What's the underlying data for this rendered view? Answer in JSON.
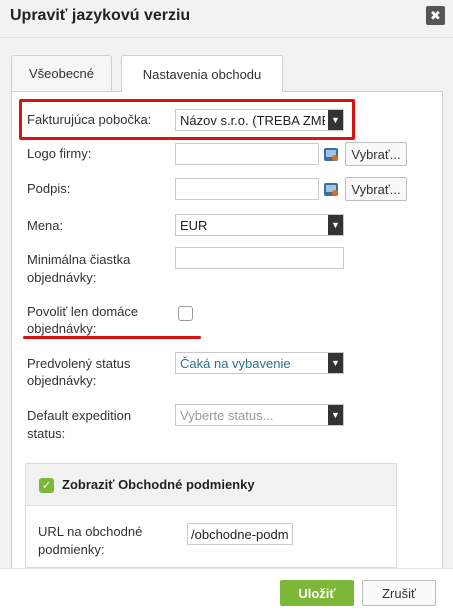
{
  "dialog": {
    "title": "Upraviť jazykovú verziu",
    "close_glyph": "✖"
  },
  "tabs": [
    {
      "label": "Všeobecné",
      "active": false
    },
    {
      "label": "Nastavenia obchodu",
      "active": true
    }
  ],
  "form": {
    "branch": {
      "label": "Fakturujúca pobočka:",
      "value": "Názov s.r.o. (TREBA ZME"
    },
    "logo": {
      "label": "Logo firmy:",
      "value": "",
      "button": "Vybrať..."
    },
    "signature": {
      "label": "Podpis:",
      "value": "",
      "button": "Vybrať..."
    },
    "currency": {
      "label": "Mena:",
      "value": "EUR"
    },
    "min_order": {
      "label_line1": "Minimálna čiastka",
      "label_line2": "objednávky:",
      "value": ""
    },
    "domestic_only": {
      "label_line1": "Povoliť len domáce",
      "label_line2": "objednávky:",
      "checked": false
    },
    "default_status": {
      "label_line1": "Predvolený status",
      "label_line2": "objednávky:",
      "value": "Čaká na vybavenie"
    },
    "default_expedition": {
      "label_line1": "Default expedition",
      "label_line2": "status:",
      "placeholder": "Vyberte status..."
    }
  },
  "terms_section": {
    "title": "Zobraziť Obchodné podmienky",
    "checked": true,
    "url_label_line1": "URL na obchodné",
    "url_label_line2": "podmienky:",
    "url_value": "/obchodne-podm"
  },
  "footer": {
    "save_label": "Uložiť",
    "cancel_label": "Zrušiť"
  },
  "icons": {
    "close": "close-icon",
    "dropdown": "chevron-down-icon",
    "image": "image-icon",
    "check": "checkmark-icon"
  },
  "colors": {
    "accent_green": "#7db73a",
    "highlight_red": "#dd1111",
    "status_teal": "#2f6f8c"
  }
}
